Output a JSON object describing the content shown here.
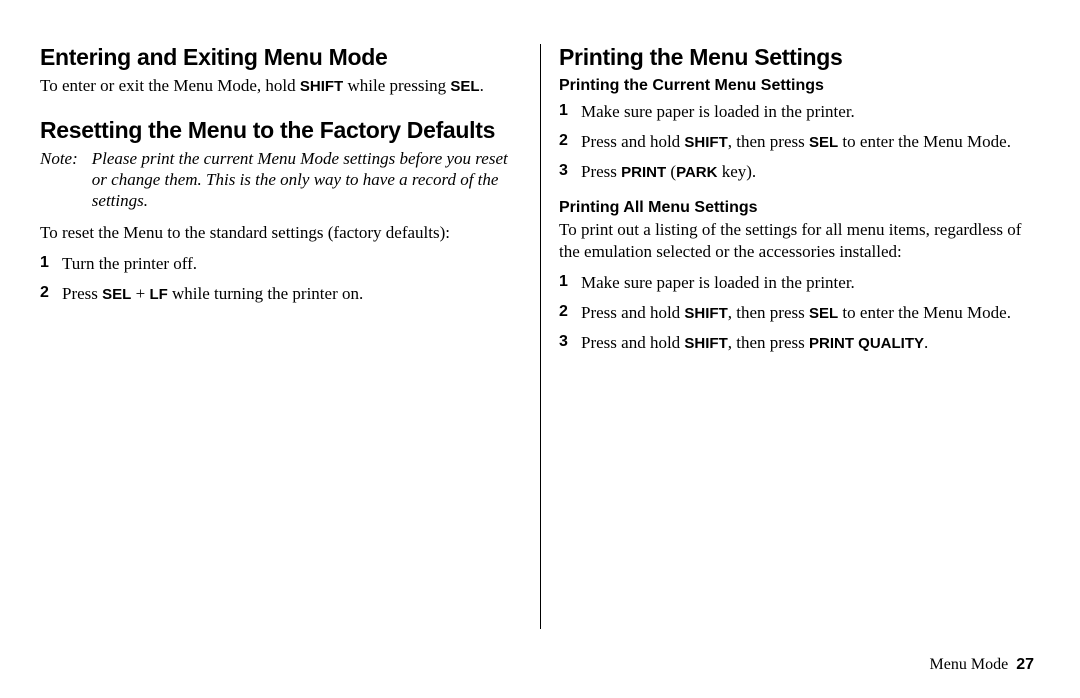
{
  "left": {
    "h1a": "Entering and Exiting Menu Mode",
    "p1_a": "To enter or exit the Menu Mode, hold ",
    "p1_b": "SHIFT",
    "p1_c": " while pressing ",
    "p1_d": "SEL",
    "p1_e": ".",
    "h1b": "Resetting the Menu to the Factory Defaults",
    "note_label": "Note:",
    "note_text": "Please print the current Menu Mode settings before you reset or change them. This is the only way to have a record of the settings.",
    "p2": "To reset the Menu to the standard settings (factory defaults):",
    "step1": "Turn the printer off.",
    "step2_a": "Press ",
    "step2_b": "SEL",
    "step2_c": " + ",
    "step2_d": "LF",
    "step2_e": " while turning the printer on."
  },
  "right": {
    "h1": "Printing the Menu Settings",
    "h2a": "Printing the Current Menu Settings",
    "a1": "Make sure paper is loaded in the printer.",
    "a2_a": "Press and hold ",
    "a2_b": "SHIFT",
    "a2_c": ", then press ",
    "a2_d": "SEL",
    "a2_e": " to enter the Menu Mode.",
    "a3_a": "Press ",
    "a3_b": "PRINT",
    "a3_c": " (",
    "a3_d": "PARK",
    "a3_e": " key).",
    "h2b": "Printing All Menu Settings",
    "p1": "To print out a listing of the settings for all menu items, regardless of the emulation selected or the accessories installed:",
    "b1": "Make sure paper is loaded in the printer.",
    "b2_a": "Press and hold ",
    "b2_b": "SHIFT",
    "b2_c": ", then press ",
    "b2_d": "SEL",
    "b2_e": " to enter the Menu Mode.",
    "b3_a": "Press and hold ",
    "b3_b": "SHIFT",
    "b3_c": ", then press ",
    "b3_d": "PRINT QUALITY",
    "b3_e": "."
  },
  "footer": {
    "section": "Menu Mode",
    "page": "27"
  }
}
